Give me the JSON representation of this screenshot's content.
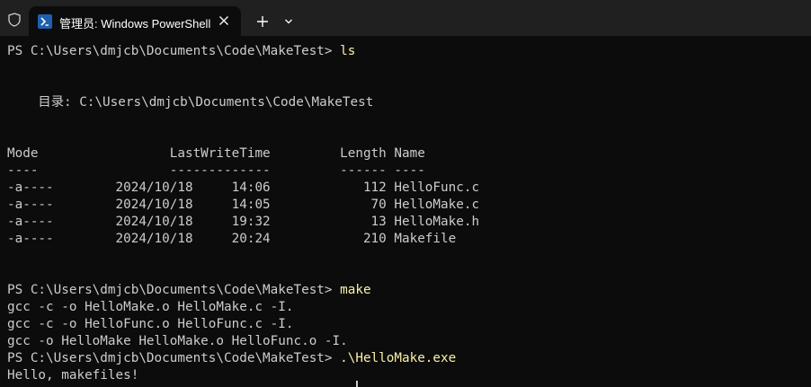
{
  "window": {
    "tab_title": "管理员: Windows PowerShell",
    "shield_icon": "shield-icon",
    "powershell_icon": "powershell-icon",
    "close_icon": "close-icon",
    "new_tab_icon": "plus-icon",
    "dropdown_icon": "chevron-down-icon"
  },
  "colors": {
    "background": "#0c0c0c",
    "titlebar": "#202020",
    "text": "#cccccc",
    "command": "#f9f1a5"
  },
  "terminal": {
    "line_01_prompt": "PS C:\\Users\\dmjcb\\Documents\\Code\\MakeTest> ",
    "line_01_cmd": "ls",
    "line_02": "    目录: C:\\Users\\dmjcb\\Documents\\Code\\MakeTest",
    "line_03": "Mode                 LastWriteTime         Length Name",
    "line_04": "----                 -------------         ------ ----",
    "line_05": "-a----        2024/10/18     14:06            112 HelloFunc.c",
    "line_06": "-a----        2024/10/18     14:05             70 HelloMake.c",
    "line_07": "-a----        2024/10/18     19:32             13 HelloMake.h",
    "line_08": "-a----        2024/10/18     20:24            210 Makefile",
    "line_09_prompt": "PS C:\\Users\\dmjcb\\Documents\\Code\\MakeTest> ",
    "line_09_cmd": "make",
    "line_10": "gcc -c -o HelloMake.o HelloMake.c -I.",
    "line_11": "gcc -c -o HelloFunc.o HelloFunc.c -I.",
    "line_12": "gcc -o HelloMake HelloMake.o HelloFunc.o -I.",
    "line_13_prompt": "PS C:\\Users\\dmjcb\\Documents\\Code\\MakeTest> ",
    "line_13_cmd": ".\\HelloMake.exe",
    "line_14": "Hello, makefiles!"
  }
}
